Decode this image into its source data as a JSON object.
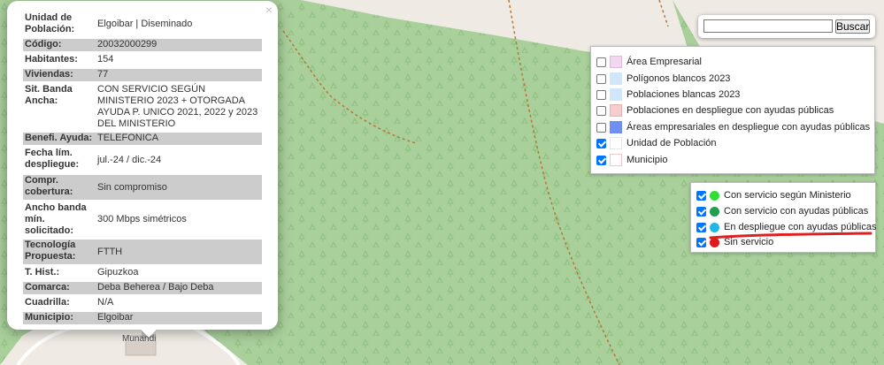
{
  "map": {
    "place_label": "Munandi",
    "colors": {
      "forest": "#a9cf9b",
      "clearing": "#efeae4",
      "path": "#a0522d"
    }
  },
  "popup": {
    "close_label": "×",
    "rows": [
      {
        "key": "Unidad de Población:",
        "value": "Elgoibar | Diseminado"
      },
      {
        "key": "Código:",
        "value": "20032000299"
      },
      {
        "key": "Habitantes:",
        "value": "154"
      },
      {
        "key": "Viviendas:",
        "value": "77"
      },
      {
        "key": "Sit. Banda Ancha:",
        "value": "CON SERVICIO SEGÚN MINISTERIO 2023 + OTORGADA AYUDA P. UNICO 2021, 2022 y 2023 DEL MINISTERIO"
      },
      {
        "key": "Benefi. Ayuda:",
        "value": "TELEFONICA"
      },
      {
        "key": "Fecha lím. despliegue:",
        "value": "jul.-24 / dic.-24"
      },
      {
        "key": "Compr. cobertura:",
        "value": "Sin compromiso"
      },
      {
        "key": "Ancho banda mín. solicitado:",
        "value": "300 Mbps simétricos"
      },
      {
        "key": "Tecnología Propuesta:",
        "value": "FTTH"
      },
      {
        "key": "T. Hist.:",
        "value": "Gipuzkoa"
      },
      {
        "key": "Comarca:",
        "value": "Deba Beherea / Bajo Deba"
      },
      {
        "key": "Cuadrilla:",
        "value": "N/A"
      },
      {
        "key": "Municipio:",
        "value": "Elgoibar"
      }
    ]
  },
  "search": {
    "value": "",
    "button_label": "Buscar"
  },
  "layers": [
    {
      "label": "Área Empresarial",
      "checked": false,
      "fill": "#f2d6f2",
      "border": "#e0b8e0"
    },
    {
      "label": "Polígonos blancos 2023",
      "checked": false,
      "fill": "#cfe6fb",
      "border": "#cfe6fb"
    },
    {
      "label": "Poblaciones blancas 2023",
      "checked": false,
      "fill": "#cfe6fb",
      "border": "#cfe6fb"
    },
    {
      "label": "Poblaciones en despliegue con ayudas públicas",
      "checked": false,
      "fill": "#f6cccc",
      "border": "#e8b0b0"
    },
    {
      "label": "Áreas empresariales en despliegue con ayudas públicas",
      "checked": false,
      "fill": "#6f8ff2",
      "border": "#6f8ff2"
    },
    {
      "label": "Unidad de Población",
      "checked": true,
      "fill": "#ffffff",
      "border": "#e6e6e6"
    },
    {
      "label": "Municipio",
      "checked": true,
      "fill": "#ffffff",
      "border": "#f1c8c8"
    }
  ],
  "service_layers": [
    {
      "label": "Con servicio según Ministerio",
      "checked": true,
      "color": "#33dd33"
    },
    {
      "label": "Con servicio con ayudas públicas",
      "checked": true,
      "color": "#1f9f4f"
    },
    {
      "label": "En despliegue con ayudas públicas",
      "checked": true,
      "color": "#1fb7e8"
    },
    {
      "label": "Sin servicio",
      "checked": true,
      "color": "#e01a1a"
    }
  ],
  "annotation": {
    "color": "#e02020"
  }
}
